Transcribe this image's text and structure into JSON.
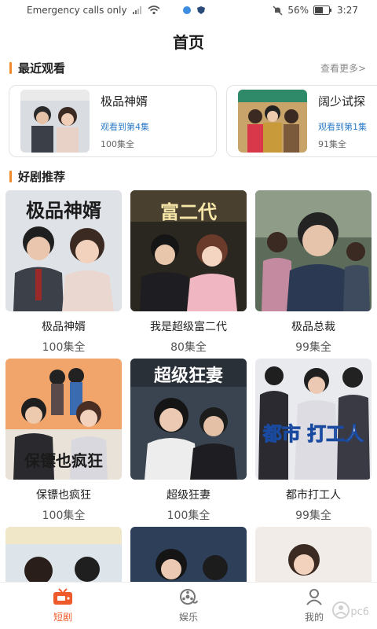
{
  "status": {
    "carrier": "Emergency calls only",
    "battery": "56%",
    "time": "3:27"
  },
  "header": {
    "title": "首页"
  },
  "recent": {
    "title": "最近观看",
    "more": "查看更多>",
    "items": [
      {
        "name": "极品神婿",
        "progress": "观看到第4集",
        "total": "100集全"
      },
      {
        "name": "阔少试探",
        "progress": "观看到第1集",
        "total": "91集全"
      }
    ]
  },
  "recommend": {
    "title": "好剧推荐",
    "items": [
      {
        "name": "极品神婿",
        "total": "100集全",
        "poster_text": "极品神婿"
      },
      {
        "name": "我是超级富二代",
        "total": "80集全",
        "poster_text": "富二代"
      },
      {
        "name": "极品总裁",
        "total": "99集全",
        "poster_text": ""
      },
      {
        "name": "保镖也疯狂",
        "total": "100集全",
        "poster_text": "保镖也疯狂"
      },
      {
        "name": "超级狂妻",
        "total": "100集全",
        "poster_text": "超级狂妻"
      },
      {
        "name": "都市打工人",
        "total": "99集全",
        "poster_text": "都市 打工人"
      },
      {
        "name": "",
        "total": "",
        "poster_text": ""
      },
      {
        "name": "",
        "total": "",
        "poster_text": ""
      },
      {
        "name": "",
        "total": "",
        "poster_text": ""
      }
    ]
  },
  "tabs": [
    {
      "label": "短剧",
      "icon": "tv-icon",
      "active": true
    },
    {
      "label": "娱乐",
      "icon": "film-reel-icon",
      "active": false
    },
    {
      "label": "我的",
      "icon": "user-icon",
      "active": false
    }
  ],
  "watermark": {
    "text": "pc6"
  },
  "colors": {
    "accent": "#f08a2a",
    "active_tab": "#ef5a2a",
    "progress": "#2f7cc8"
  }
}
